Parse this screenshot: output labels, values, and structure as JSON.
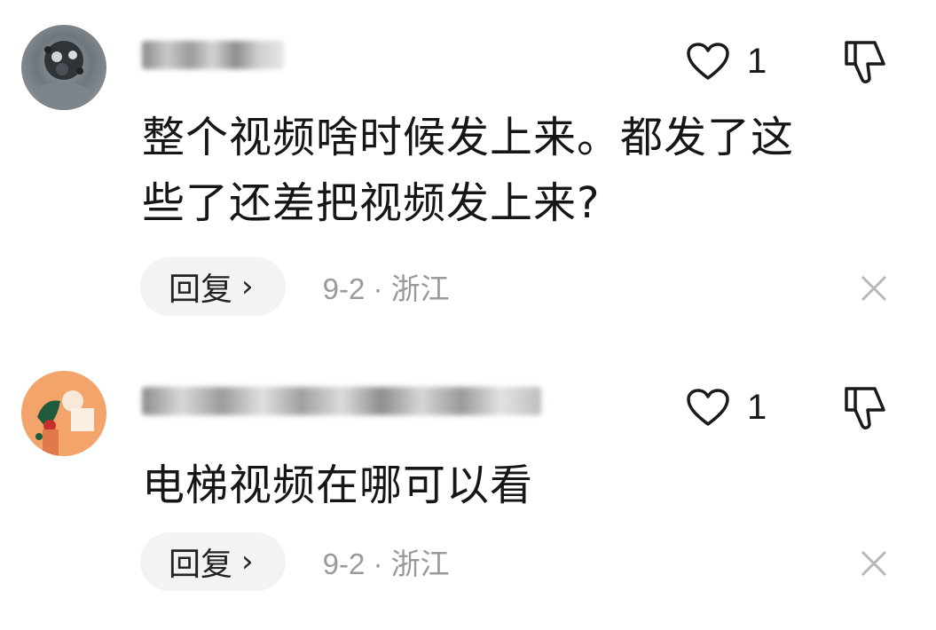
{
  "comments": [
    {
      "text_line1": "整个视频啥时候发上来。都发了这",
      "text_line2": "些了还差把视频发上来?",
      "like_count": "1",
      "reply_label": "回复",
      "reply_arrow": "›",
      "meta": "9-2 · 浙江",
      "avatar_icon": "dark-textured-avatar",
      "username_blurred": true
    },
    {
      "text_line1": "电梯视频在哪可以看",
      "like_count": "1",
      "reply_label": "回复",
      "reply_arrow": "›",
      "meta": "9-2 · 浙江",
      "avatar_icon": "orange-illustration-avatar",
      "username_blurred": true
    }
  ],
  "icons": {
    "like": "heart-outline-icon",
    "dislike": "thumbs-down-outline-icon",
    "close": "close-x-icon"
  },
  "colors": {
    "background": "#ffffff",
    "text": "#161616",
    "meta": "#9a9a9a",
    "reply_bg": "#f3f3f3",
    "icon_stroke": "#1a1a1a",
    "close_stroke": "#b8b8b8"
  }
}
